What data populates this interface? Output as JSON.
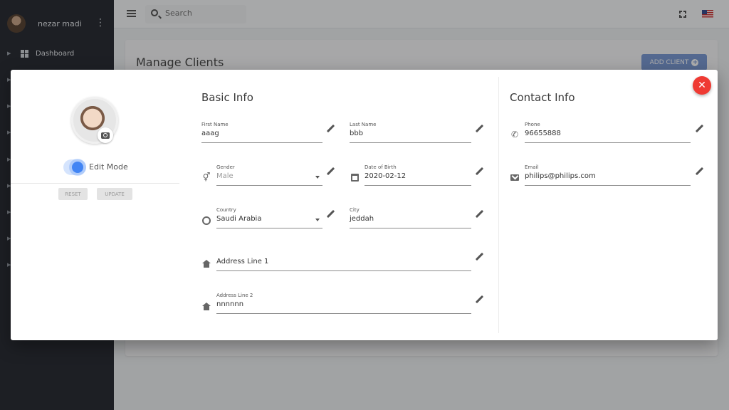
{
  "sidebar": {
    "user_name": "nezar madi",
    "items": [
      {
        "label": "Dashboard"
      }
    ]
  },
  "topbar": {
    "search_placeholder": "Search"
  },
  "page": {
    "title": "Manage Clients",
    "add_client_label": "ADD CLIENT"
  },
  "modal": {
    "close_label": "✕",
    "edit_mode_label": "Edit Mode",
    "edit_mode_on": true,
    "reset_label": "RESET",
    "update_label": "UPDATE",
    "basic_info": {
      "title": "Basic Info",
      "first_name": {
        "label": "First Name",
        "value": "aaag"
      },
      "last_name": {
        "label": "Last Name",
        "value": "bbb"
      },
      "gender": {
        "label": "Gender",
        "value": "Male"
      },
      "dob": {
        "label": "Date of Birth",
        "value": "2020-02-12"
      },
      "country": {
        "label": "Country",
        "value": "Saudi Arabia"
      },
      "city": {
        "label": "City",
        "value": "jeddah"
      },
      "address1": {
        "label": "",
        "value": "Address Line 1"
      },
      "address2": {
        "label": "Address Line 2",
        "value": "nnnnnn"
      }
    },
    "contact_info": {
      "title": "Contact Info",
      "phone": {
        "label": "Phone",
        "value": "96655888"
      },
      "email": {
        "label": "Email",
        "value": "philips@philips.com"
      }
    }
  },
  "colors": {
    "sidebar_bg": "#2b2f36",
    "accent_blue": "#4285f4",
    "close_red": "#ef3a33",
    "add_button": "#7c9bd4"
  }
}
